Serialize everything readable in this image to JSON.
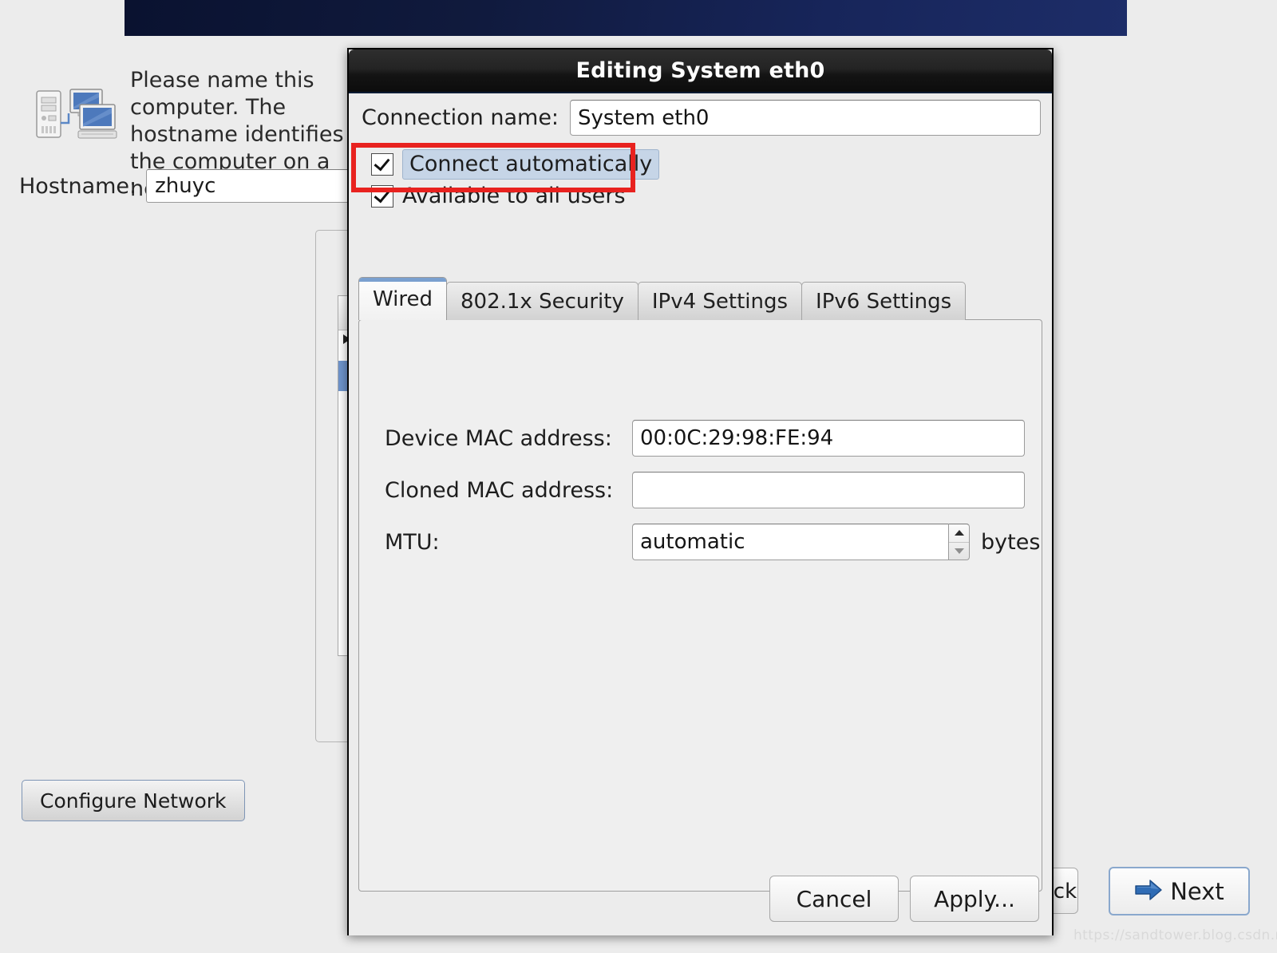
{
  "background": {
    "banner": {
      "name": "installer-banner"
    },
    "icon_name": "network-computers-icon",
    "description": "Please name this computer. The\nhostname identifies the computer on a\nnetwork.",
    "hostname_label": "Hostname:",
    "hostname_value": "zhuyc",
    "configure_network_label": "Configure Network",
    "back_button_label": "Back",
    "next_button_label": "Next",
    "watermark": "https://sandtower.blog.csdn.net"
  },
  "dialog": {
    "title": "Editing System eth0",
    "connection_name_label": "Connection name:",
    "connection_name_value": "System eth0",
    "checkboxes": [
      {
        "label": "Connect automatically",
        "checked": true,
        "focused": true
      },
      {
        "label": "Available to all users",
        "checked": true,
        "focused": false
      }
    ],
    "tabs": [
      {
        "label": "Wired",
        "active": true
      },
      {
        "label": "802.1x Security",
        "active": false
      },
      {
        "label": "IPv4 Settings",
        "active": false
      },
      {
        "label": "IPv6 Settings",
        "active": false
      }
    ],
    "wired": {
      "mac_label": "Device MAC address:",
      "mac_value": "00:0C:29:98:FE:94",
      "cloned_label": "Cloned MAC address:",
      "cloned_value": "",
      "mtu_label": "MTU:",
      "mtu_value": "automatic",
      "mtu_unit": "bytes"
    },
    "actions": {
      "cancel_label": "Cancel",
      "apply_label": "Apply..."
    }
  },
  "colors": {
    "banner": "#101a3d",
    "accent_red": "#e8221f",
    "tab_accent": "#7aa0cf",
    "focus_highlight": "#c6d5e7",
    "selection_blue": "#6f95cd"
  }
}
